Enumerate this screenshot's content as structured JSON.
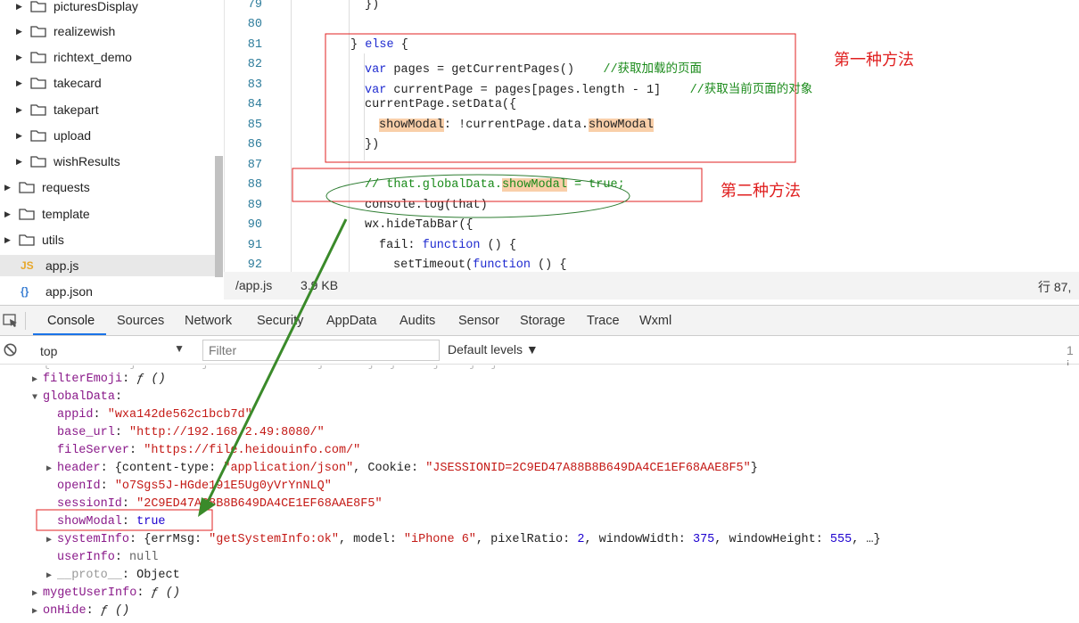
{
  "file_tree": {
    "items": [
      {
        "label": "picturesDisplay",
        "type": "folder",
        "depth": 1
      },
      {
        "label": "realizewish",
        "type": "folder",
        "depth": 1
      },
      {
        "label": "richtext_demo",
        "type": "folder",
        "depth": 1
      },
      {
        "label": "takecard",
        "type": "folder",
        "depth": 1
      },
      {
        "label": "takepart",
        "type": "folder",
        "depth": 1
      },
      {
        "label": "upload",
        "type": "folder",
        "depth": 1
      },
      {
        "label": "wishResults",
        "type": "folder",
        "depth": 1
      },
      {
        "label": "requests",
        "type": "folder",
        "depth": 0
      },
      {
        "label": "template",
        "type": "folder",
        "depth": 0
      },
      {
        "label": "utils",
        "type": "folder",
        "depth": 0
      },
      {
        "label": "app.js",
        "type": "js",
        "depth": 0,
        "icon_text": "JS"
      },
      {
        "label": "app.json",
        "type": "json",
        "depth": 0,
        "icon_text": "{}"
      }
    ]
  },
  "editor": {
    "line_numbers": [
      "79",
      "80",
      "81",
      "82",
      "83",
      "84",
      "85",
      "86",
      "87",
      "88",
      "89",
      "90",
      "91",
      "92"
    ],
    "lines": {
      "l79": "})",
      "l81_a": "} ",
      "l81_kw": "else",
      "l81_b": " {",
      "l82_kw": "var",
      "l82_a": " pages = getCurrentPages()    ",
      "l82_cm": "//获取加载的页面",
      "l83_kw": "var",
      "l83_a": " currentPage = pages[pages.length - 1]    ",
      "l83_cm": "//获取当前页面的对象",
      "l84": "currentPage.setData({",
      "l85_hl1": "showModal",
      "l85_a": ": !currentPage.data.",
      "l85_hl2": "showModal",
      "l86": "})",
      "l88_cm1": "// that.globalData.",
      "l88_hl": "showModal",
      "l88_cm2": " = true;",
      "l89": "console.log(that)",
      "l90": "wx.hideTabBar({",
      "l91_a": "fail: ",
      "l91_kw": "function",
      "l91_b": " () {",
      "l92_a": "setTimeout(",
      "l92_kw": "function",
      "l92_b": " () {"
    }
  },
  "annotations": {
    "method1": "第一种方法",
    "method2": "第二种方法",
    "box_color": "#e02020",
    "ellipse_color": "#2e7d32",
    "arrow_color": "#3a8a2a"
  },
  "statusbar": {
    "path": "/app.js",
    "size": "3.9 KB",
    "cursor": "行 87,"
  },
  "devtools": {
    "tabs": [
      "Console",
      "Sources",
      "Network",
      "Security",
      "AppData",
      "Audits",
      "Sensor",
      "Storage",
      "Trace",
      "Wxml"
    ],
    "active_tab": "Console",
    "context": "top",
    "filter_placeholder": "Filter",
    "levels": "Default levels ▼",
    "count": "1 i"
  },
  "console": {
    "filterEmoji": {
      "key": "filterEmoji",
      "val": "ƒ ()"
    },
    "globalData": {
      "key": "globalData"
    },
    "appid": {
      "key": "appid",
      "val": "\"wxa142de562c1bcb7d\""
    },
    "base_url": {
      "key": "base_url",
      "val": "\"http://192.168.2.49:8080/\""
    },
    "fileServer": {
      "key": "fileServer",
      "val": "\"https://file.heidouinfo.com/\""
    },
    "header": {
      "key": "header",
      "k1": "content-type",
      "v1": "\"application/json\"",
      "k2": "Cookie",
      "v2": "\"JSESSIONID=2C9ED47A88B8B649DA4CE1EF68AAE8F5\""
    },
    "openId": {
      "key": "openId",
      "val": "\"o7Sgs5J-HGde191E5Ug0yVrYnNLQ\""
    },
    "sessionId": {
      "key": "sessionId",
      "val": "\"2C9ED47A88B8B649DA4CE1EF68AAE8F5\""
    },
    "showModal": {
      "key": "showModal",
      "val": "true"
    },
    "systemInfo": {
      "key": "systemInfo",
      "k1": "errMsg",
      "v1": "\"getSystemInfo:ok\"",
      "k2": "model",
      "v2": "\"iPhone 6\"",
      "k3": "pixelRatio",
      "v3": "2",
      "k4": "windowWidth",
      "v4": "375",
      "k5": "windowHeight",
      "v5": "555",
      "more": "…}"
    },
    "userInfo": {
      "key": "userInfo",
      "val": "null"
    },
    "proto": {
      "key": "__proto__",
      "val": "Object"
    },
    "mygetUserInfo": {
      "key": "mygetUserInfo",
      "val": "ƒ ()"
    },
    "onHide": {
      "key": "onHide",
      "val": "ƒ ()"
    }
  }
}
